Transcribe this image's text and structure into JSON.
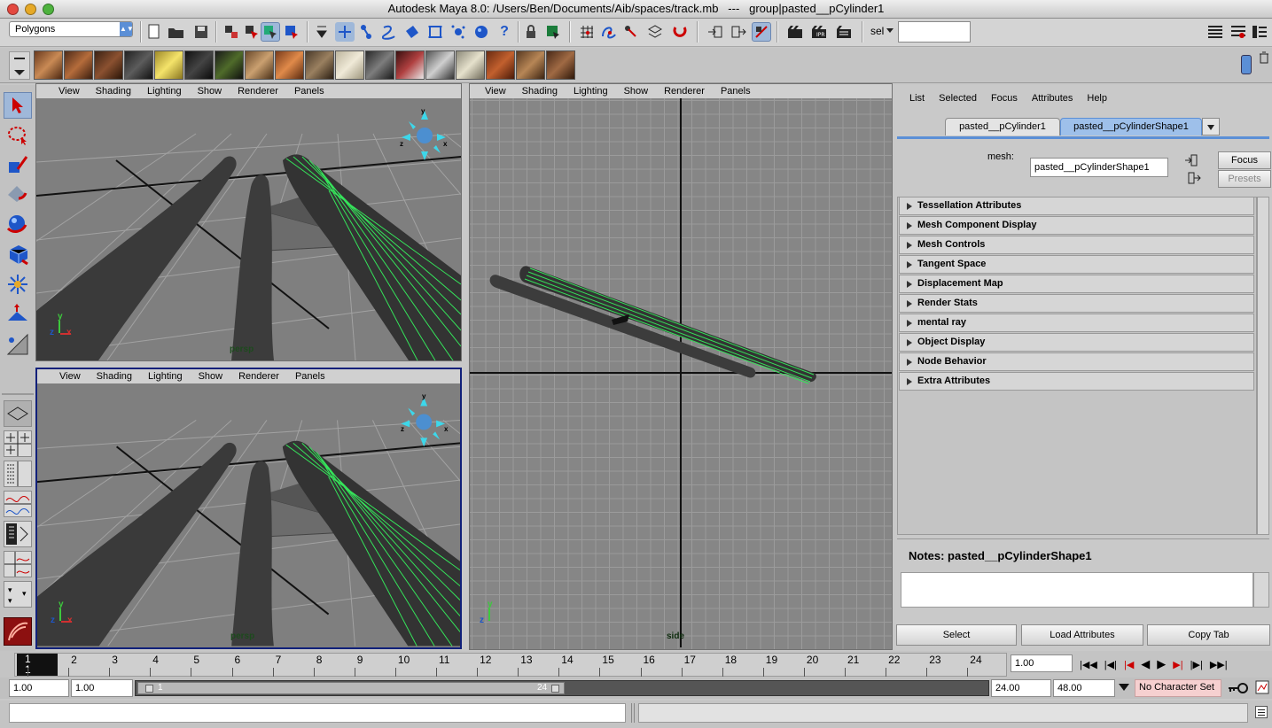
{
  "window": {
    "title": "Autodesk Maya 8.0: /Users/Ben/Documents/Aib/spaces/track.mb   ---   group|pasted__pCylinder1",
    "close_color": "#e3483f",
    "minimize_color": "#e6a927",
    "zoom_color": "#4eb23e"
  },
  "toolbar": {
    "menu_set": "Polygons",
    "sel_label": "sel",
    "sel_value": ""
  },
  "viewport_menu": [
    "View",
    "Shading",
    "Lighting",
    "Show",
    "Renderer",
    "Panels"
  ],
  "viewports": {
    "top_left": {
      "camera": "persp"
    },
    "bottom_left": {
      "camera": "persp"
    },
    "right": {
      "camera": "side"
    }
  },
  "axis": {
    "x": "x",
    "y": "y",
    "z": "z"
  },
  "attribute_editor": {
    "menu": [
      "List",
      "Selected",
      "Focus",
      "Attributes",
      "Help"
    ],
    "tabs": [
      "pasted__pCylinder1",
      "pasted__pCylinderShape1"
    ],
    "mesh_label": "mesh:",
    "mesh_value": "pasted__pCylinderShape1",
    "focus_button": "Focus",
    "presets_button": "Presets",
    "sections": [
      "Tessellation Attributes",
      "Mesh Component Display",
      "Mesh Controls",
      "Tangent Space",
      "Displacement Map",
      "Render Stats",
      "mental ray",
      "Object Display",
      "Node Behavior",
      "Extra Attributes"
    ],
    "notes_title": "Notes: pasted__pCylinderShape1",
    "notes_text": "",
    "bottom_buttons": [
      "Select",
      "Load Attributes",
      "Copy Tab"
    ]
  },
  "timeline": {
    "ticks": [
      "1",
      "2",
      "3",
      "4",
      "5",
      "6",
      "7",
      "8",
      "9",
      "10",
      "11",
      "12",
      "13",
      "14",
      "15",
      "16",
      "17",
      "18",
      "19",
      "20",
      "21",
      "22",
      "23",
      "24"
    ],
    "current_frame": "1",
    "current_frame_field": "1.00"
  },
  "range": {
    "start": "1.00",
    "playback_start": "1.00",
    "slider_start": "1",
    "slider_end": "24",
    "playback_end": "24.00",
    "end": "48.00",
    "character_set": "No Character Set"
  },
  "command_line": {
    "input": "",
    "feedback": ""
  }
}
